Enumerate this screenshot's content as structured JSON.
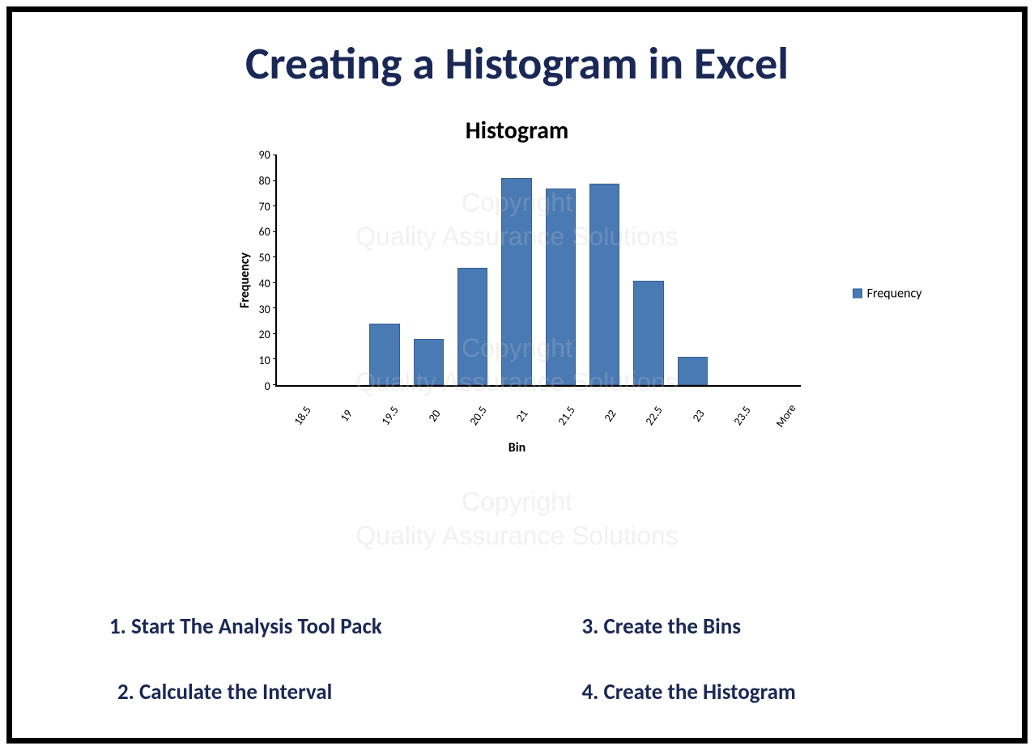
{
  "title": "Creating a Histogram in Excel",
  "watermark_line1": "Copyright",
  "watermark_line2": "Quality Assurance Solutions",
  "chart_data": {
    "type": "bar",
    "title": "Histogram",
    "xlabel": "Bin",
    "ylabel": "Frequency",
    "ylim": [
      0,
      90
    ],
    "yticks": [
      0,
      10,
      20,
      30,
      40,
      50,
      60,
      70,
      80,
      90
    ],
    "categories": [
      "18.5",
      "19",
      "19.5",
      "20",
      "20.5",
      "21",
      "21.5",
      "22",
      "22.5",
      "23",
      "23.5",
      "More"
    ],
    "values": [
      0,
      0,
      24,
      18,
      46,
      81,
      77,
      79,
      41,
      11,
      0,
      0
    ],
    "legend": "Frequency",
    "series_color": "#4a7ab4"
  },
  "steps": {
    "s1": "1. Start The Analysis Tool Pack",
    "s2": "3. Create the Bins",
    "s3": "2. Calculate the Interval",
    "s4": "4. Create the Histogram"
  }
}
